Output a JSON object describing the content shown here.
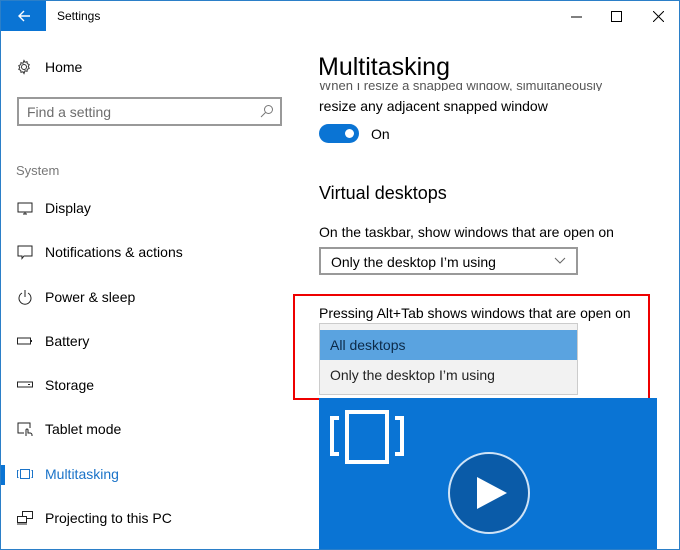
{
  "window": {
    "title": "Settings",
    "controls": [
      "minimize",
      "maximize",
      "close"
    ]
  },
  "sidebar": {
    "home_label": "Home",
    "search": {
      "placeholder": "Find a setting",
      "value": ""
    },
    "section_label": "System",
    "items": [
      {
        "label": "Display",
        "icon": "display-icon",
        "active": false
      },
      {
        "label": "Notifications & actions",
        "icon": "notifications-icon",
        "active": false
      },
      {
        "label": "Power & sleep",
        "icon": "power-icon",
        "active": false
      },
      {
        "label": "Battery",
        "icon": "battery-icon",
        "active": false
      },
      {
        "label": "Storage",
        "icon": "storage-icon",
        "active": false
      },
      {
        "label": "Tablet mode",
        "icon": "tablet-mode-icon",
        "active": false
      },
      {
        "label": "Multitasking",
        "icon": "multitasking-icon",
        "active": true
      },
      {
        "label": "Projecting to this PC",
        "icon": "projecting-icon",
        "active": false
      }
    ]
  },
  "main": {
    "page_title": "Multitasking",
    "snap": {
      "faded_text": "When I resize a snapped window, simultaneously",
      "description": "resize any adjacent snapped window",
      "toggle_state": "On",
      "toggle_on": true
    },
    "virtual_desktops": {
      "heading": "Virtual desktops",
      "taskbar_label": "On the taskbar, show windows that are open on",
      "taskbar_value": "Only the desktop I’m using",
      "alttab_label": "Pressing Alt+Tab shows windows that are open on",
      "alttab_options": [
        {
          "label": "All desktops",
          "selected": true
        },
        {
          "label": "Only the desktop I’m using",
          "selected": false
        }
      ]
    },
    "video": {
      "play_icon": "play-icon",
      "thumbnail_icon": "multitasking-icon"
    }
  },
  "colors": {
    "accent": "#0a74d4",
    "selected_option": "#5aa3e0",
    "highlight_border": "#ee0000",
    "active_nav_text": "#1a73c8"
  }
}
